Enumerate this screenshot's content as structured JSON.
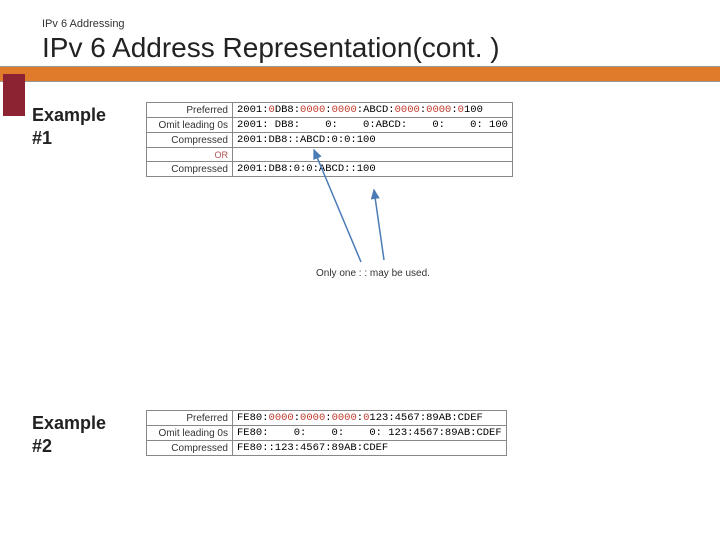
{
  "header": {
    "pre_title": "IPv 6 Addressing",
    "title": "IPv 6 Address Representation(cont. )"
  },
  "example1": {
    "label": "Example #1",
    "rows": {
      "preferred_label": "Preferred",
      "omit_label": "Omit leading 0s",
      "compressed_label": "Compressed",
      "or_label": "OR",
      "compressed2_label": "Compressed"
    },
    "addr": {
      "pref_p1": "2001:",
      "pref_p2": "0",
      "pref_p3": "DB8:",
      "pref_p4": "0000",
      "pref_p5": ":",
      "pref_p6": "0000",
      "pref_p7": ":ABCD:",
      "pref_p8": "0000",
      "pref_p9": ":",
      "pref_p10": "0000",
      "pref_p11": ":",
      "pref_p12": "0",
      "pref_p13": "100",
      "omit": "2001: DB8:    0:    0:ABCD:    0:    0: 100",
      "comp1": "2001:DB8::ABCD:0:0:100",
      "comp2": "2001:DB8:0:0:ABCD::100"
    },
    "note": "Only one : : may be used."
  },
  "example2": {
    "label": "Example #2",
    "rows": {
      "preferred_label": "Preferred",
      "omit_label": "Omit leading 0s",
      "compressed_label": "Compressed"
    },
    "addr": {
      "pref_p1": "FE80:",
      "pref_p2": "0000",
      "pref_p3": ":",
      "pref_p4": "0000",
      "pref_p5": ":",
      "pref_p6": "0000",
      "pref_p7": ":",
      "pref_p8": "0",
      "pref_p9": "123:4567:89AB:CDEF",
      "omit": "FE80:    0:    0:    0: 123:4567:89AB:CDEF",
      "comp": "FE80::123:4567:89AB:CDEF"
    }
  }
}
